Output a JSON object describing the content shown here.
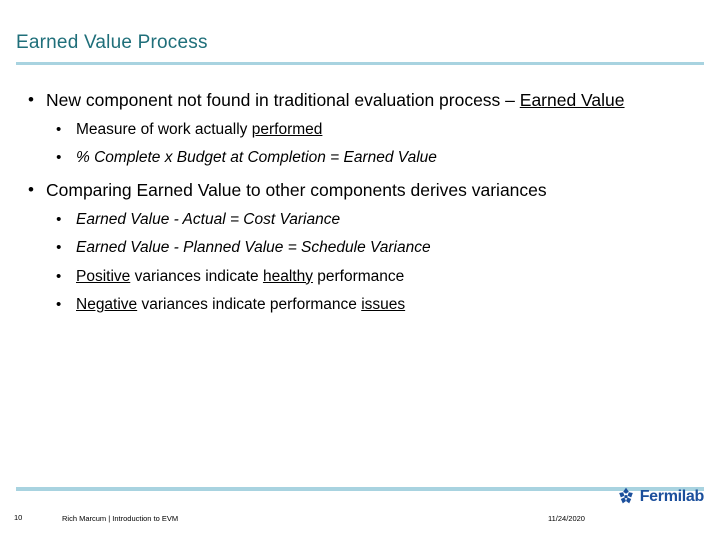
{
  "slide": {
    "title": "Earned Value Process",
    "bullets": [
      {
        "text_before": "New component not found in traditional evaluation process – ",
        "text_underline": "Earned Value",
        "sub": [
          {
            "pre": "Measure of work actually ",
            "underline": "performed",
            "post": "",
            "italic": false
          },
          {
            "pre": "",
            "underline": "",
            "post": "% Complete x Budget at Completion = Earned Value",
            "italic": true
          }
        ]
      },
      {
        "text_before": "Comparing Earned Value to other components derives variances",
        "text_underline": "",
        "sub": [
          {
            "pre": "",
            "underline": "",
            "post": "Earned Value - Actual = Cost Variance",
            "italic": true
          },
          {
            "pre": "",
            "underline": "",
            "post": "Earned Value - Planned Value = Schedule Variance",
            "italic": true
          },
          {
            "pre": "",
            "underline": "Positive",
            "post": " variances indicate ",
            "post2_underline": "healthy",
            "post3": " performance",
            "italic": false
          },
          {
            "pre": "",
            "underline": "Negative",
            "post": " variances indicate performance ",
            "post2_underline": "issues",
            "post3": "",
            "italic": false
          }
        ]
      }
    ]
  },
  "footer": {
    "slide_number": "10",
    "center_text": "Rich Marcum | Introduction to EVM",
    "date": "11/24/2020",
    "logo_text": "Fermilab",
    "accent_color": "#a8d3e0",
    "title_color": "#1f6f7a",
    "logo_color": "#1b4f9c"
  }
}
